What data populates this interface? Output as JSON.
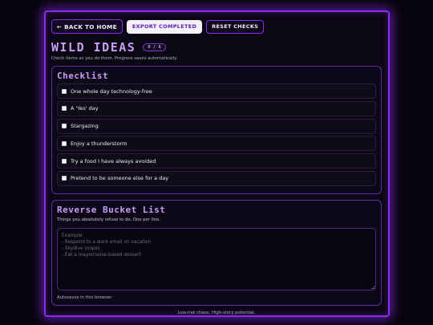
{
  "toolbar": {
    "back_label": "← BACK TO HOME",
    "export_label": "EXPORT COMPLETED",
    "reset_label": "RESET CHECKS"
  },
  "header": {
    "title": "WILD IDEAS",
    "progress": "0 / 6",
    "subtitle": "Check items as you do them. Progress saves automatically."
  },
  "checklist": {
    "heading": "Checklist",
    "items": [
      {
        "label": "One whole day technology-free",
        "checked": false
      },
      {
        "label": "A 'Yes' day",
        "checked": false
      },
      {
        "label": "Stargazing",
        "checked": false
      },
      {
        "label": "Enjoy a thunderstorm",
        "checked": false
      },
      {
        "label": "Try a food I have always avoided",
        "checked": false
      },
      {
        "label": "Pretend to be someone else for a day",
        "checked": false
      }
    ]
  },
  "reverse": {
    "heading": "Reverse Bucket List",
    "hint": "Things you absolutely refuse to do. One per line.",
    "placeholder_lines": [
      "Example:",
      "- Respond to a work email on vacation",
      "- Skydive (nope)",
      "- Eat a mayonnaise-based dessert"
    ],
    "value": "",
    "autosave_note": "Autosaves in this browser."
  },
  "footer": {
    "text": "Low-risk chaos. High-story potential."
  },
  "colors": {
    "accent": "#8b2cf0",
    "title": "#c79cf5",
    "background": "#07040d"
  }
}
